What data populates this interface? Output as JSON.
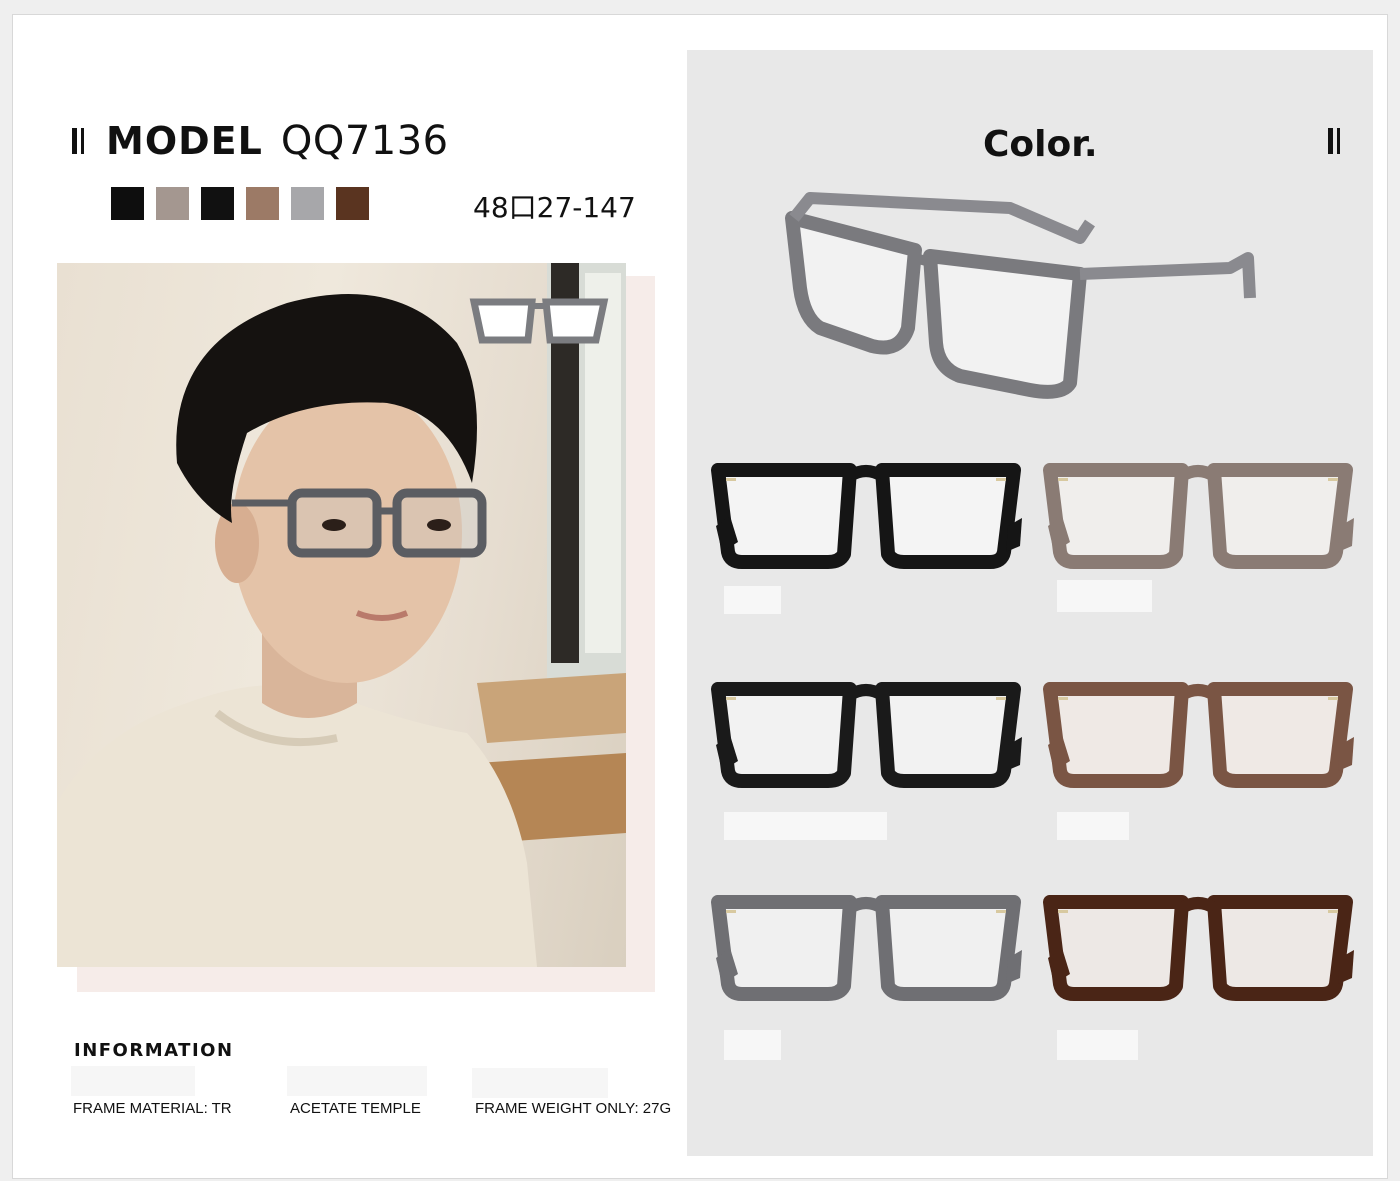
{
  "header": {
    "model_label": "MODEL",
    "model_code": "QQ7136",
    "size": "48口27-147"
  },
  "swatches": [
    {
      "name": "black",
      "color": "#0e0e0e"
    },
    {
      "name": "taupe",
      "color": "#a49790"
    },
    {
      "name": "black-clear",
      "color": "#111111"
    },
    {
      "name": "brown",
      "color": "#9c7a66"
    },
    {
      "name": "grey",
      "color": "#a7a7aa"
    },
    {
      "name": "tortoise",
      "color": "#5a3420"
    }
  ],
  "info": {
    "title": "INFORMATION",
    "items": [
      "FRAME MATERIAL: TR",
      "ACETATE TEMPLE",
      "FRAME WEIGHT ONLY: 27G"
    ]
  },
  "color_panel": {
    "title": "Color.",
    "variants": [
      {
        "name": "black",
        "color": "#151515",
        "lens_tint": "#f4f4f4"
      },
      {
        "name": "taupe",
        "color": "#8a7b74",
        "lens_tint": "#f0eeec"
      },
      {
        "name": "black-clear",
        "color": "#1a1a1a",
        "lens_tint": "#f2f2f2"
      },
      {
        "name": "brown",
        "color": "#7a5544",
        "lens_tint": "#efe9e5"
      },
      {
        "name": "grey",
        "color": "#6f6f73",
        "lens_tint": "#f0f0f0"
      },
      {
        "name": "tortoise",
        "color": "#4a2516",
        "lens_tint": "#ede8e5"
      }
    ]
  }
}
